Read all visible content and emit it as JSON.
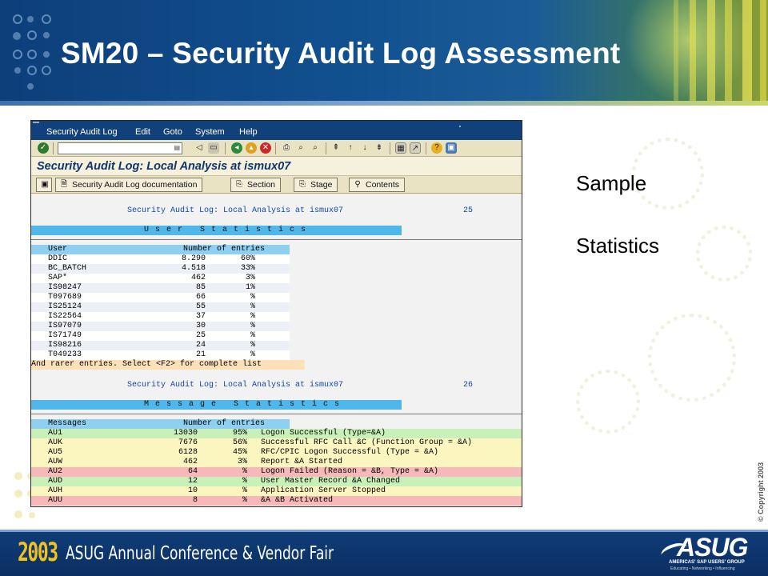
{
  "slide": {
    "title": "SM20 – Security Audit Log Assessment",
    "side_text": [
      "Sample",
      "Statistics"
    ],
    "copyright": "© Copyright 2003",
    "footer": {
      "year": "2003",
      "event": "ASUG Annual Conference & Vendor Fair",
      "logo": "ASUG",
      "logo_sub": "AMERICAS' SAP USERS' GROUP",
      "logo_tagline": "Educating • Networking • Influencing"
    }
  },
  "sap": {
    "menu": [
      "Security Audit Log",
      "Edit",
      "Goto",
      "System",
      "Help"
    ],
    "command_field": {
      "value": "",
      "placeholder": ""
    },
    "screen_title": "Security Audit Log: Local Analysis at ismux07",
    "app_toolbar": {
      "doc_label": "Security Audit Log documentation",
      "section_label": "Section",
      "stage_label": "Stage",
      "contents_label": "Contents"
    }
  },
  "report": {
    "page1_header": "Security Audit Log: Local Analysis at ismux07",
    "page1_number": "25",
    "user_stats_title": "User Statistics",
    "user_table": {
      "headers": [
        "User",
        "Number of entries"
      ],
      "rows": [
        {
          "user": "DDIC",
          "count": "8.290",
          "pct": "60%"
        },
        {
          "user": "BC_BATCH",
          "count": "4.518",
          "pct": "33%"
        },
        {
          "user": "SAP*",
          "count": "462",
          "pct": "3%"
        },
        {
          "user": "IS98247",
          "count": "85",
          "pct": "1%"
        },
        {
          "user": "T097689",
          "count": "66",
          "pct": "%"
        },
        {
          "user": "IS25124",
          "count": "55",
          "pct": "%"
        },
        {
          "user": "IS22564",
          "count": "37",
          "pct": "%"
        },
        {
          "user": "IS97079",
          "count": "30",
          "pct": "%"
        },
        {
          "user": "IS71749",
          "count": "25",
          "pct": "%"
        },
        {
          "user": "IS98216",
          "count": "24",
          "pct": "%"
        },
        {
          "user": "T049233",
          "count": "21",
          "pct": "%"
        }
      ],
      "footer_note": "And rarer entries. Select <F2> for complete list"
    },
    "page2_header": "Security Audit Log: Local Analysis at ismux07",
    "page2_number": "26",
    "message_stats_title": "Message Statistics",
    "message_table": {
      "headers": [
        "Messages",
        "Number of entries"
      ],
      "rows": [
        {
          "code": "AU1",
          "count": "13030",
          "pct": "95%",
          "text": "Logon Successful (Type=&A)",
          "color": "#c8f0b8"
        },
        {
          "code": "AUK",
          "count": "7676",
          "pct": "56%",
          "text": "Successful RFC Call &C (Function Group = &A)",
          "color": "#fbf5c0"
        },
        {
          "code": "AU5",
          "count": "6128",
          "pct": "45%",
          "text": "RFC/CPIC Logon Successful (Type = &A)",
          "color": "#fbf5c0"
        },
        {
          "code": "AUW",
          "count": "462",
          "pct": "3%",
          "text": "Report &A Started",
          "color": "#fbf5c0"
        },
        {
          "code": "AU2",
          "count": "64",
          "pct": "%",
          "text": "Logon Failed (Reason = &B, Type = &A)",
          "color": "#f6b8b8"
        },
        {
          "code": "AUD",
          "count": "12",
          "pct": "%",
          "text": "User Master Record &A Changed",
          "color": "#c8f0b8"
        },
        {
          "code": "AUH",
          "count": "10",
          "pct": "%",
          "text": "Application Server Stopped",
          "color": "#fbf5c0"
        },
        {
          "code": "AUU",
          "count": "8",
          "pct": "%",
          "text": "&A &B Activated",
          "color": "#f6b8b8"
        }
      ]
    }
  }
}
